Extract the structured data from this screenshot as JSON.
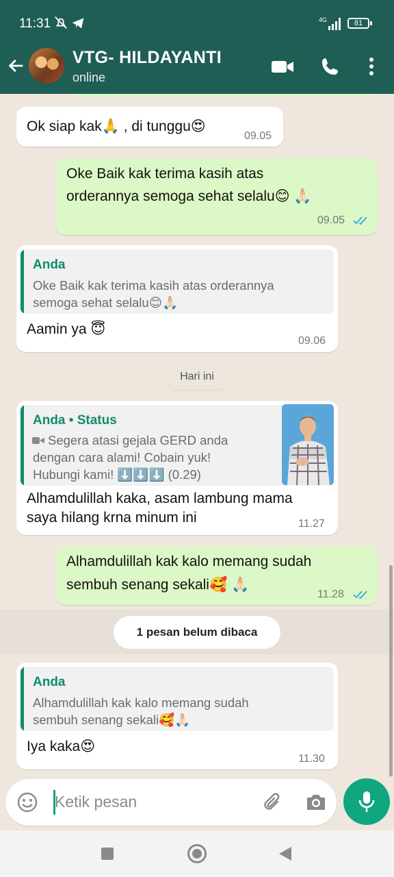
{
  "status_bar": {
    "time": "11:31",
    "network": "4G",
    "battery": "81"
  },
  "header": {
    "contact_name": "VTG- HILDAYANTI",
    "presence": "online"
  },
  "messages": [
    {
      "dir": "in",
      "text": "Ok siap kak🙏 , di tunggu😍",
      "time": "09.05"
    },
    {
      "dir": "out",
      "line1": "Oke Baik kak terima kasih atas",
      "line2": "orderannya semoga sehat selalu😊 🙏🏻",
      "time": "09.05"
    },
    {
      "dir": "in",
      "quote_author": "Anda",
      "quote_line1": "Oke Baik kak terima kasih atas orderannya",
      "quote_line2": "semoga sehat selalu😊🙏🏻",
      "text": "Aamin ya 😇",
      "time": "09.06"
    },
    {
      "dir": "in",
      "quote_author": "Anda • Status",
      "quote_line1": "Segera atasi gejala GERD anda",
      "quote_line2": "dengan cara alami! Cobain yuk!",
      "quote_line3": "Hubungi kami! ⬇️⬇️⬇️ (0.29)",
      "line1": "Alhamdulillah kaka, asam lambung mama",
      "line2": "saya hilang  krna minum ini",
      "time": "11.27"
    },
    {
      "dir": "out",
      "line1": "Alhamdulillah kak kalo memang sudah",
      "line2": "sembuh senang sekali🥰 🙏🏻",
      "time": "11.28"
    },
    {
      "dir": "in",
      "quote_author": "Anda",
      "quote_line1": "Alhamdulillah kak kalo memang sudah",
      "quote_line2": "sembuh senang sekali🥰🙏🏻",
      "text": "Iya kaka😍",
      "time": "11.30"
    }
  ],
  "date_divider": "Hari ini",
  "unread_banner": "1 pesan belum dibaca",
  "composer": {
    "placeholder": "Ketik pesan"
  },
  "colors": {
    "header": "#1f5e54",
    "accent": "#0e8c6c",
    "outgoing_bubble": "#dcf8c6",
    "read_ticks": "#34a7e0"
  }
}
